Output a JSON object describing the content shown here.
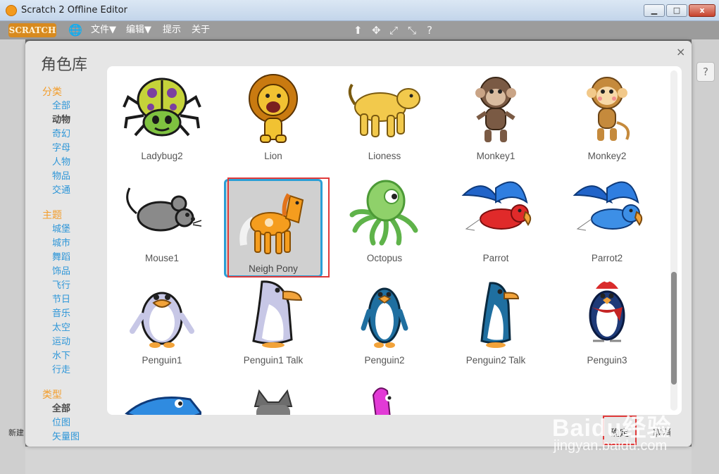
{
  "window": {
    "title": "Scratch 2 Offline Editor",
    "min_glyph": "▁",
    "max_glyph": "□",
    "close_glyph": "x"
  },
  "menubar": {
    "logo": "SCRATCH",
    "globe_glyph": "🌐",
    "file": "文件▼",
    "edit": "编辑▼",
    "tips": "提示",
    "about": "关于",
    "tools": [
      "⬆",
      "✥",
      "⤢",
      "⤡",
      "?"
    ]
  },
  "dialog": {
    "title": "角色库",
    "close_glyph": "×",
    "ok_label": "确定",
    "cancel_label": "取消"
  },
  "sidebar": {
    "category_heading": "分类",
    "categories": [
      "全部",
      "动物",
      "奇幻",
      "字母",
      "人物",
      "物品",
      "交通"
    ],
    "selected_category": "动物",
    "theme_heading": "主题",
    "themes": [
      "城堡",
      "城市",
      "舞蹈",
      "饰品",
      "飞行",
      "节日",
      "音乐",
      "太空",
      "运动",
      "水下",
      "行走"
    ],
    "type_heading": "类型",
    "types": [
      "全部",
      "位图",
      "矢量图"
    ],
    "selected_type": "全部"
  },
  "sprites": [
    {
      "name": "Ladybug2",
      "icon": "ladybug-icon"
    },
    {
      "name": "Lion",
      "icon": "lion-icon"
    },
    {
      "name": "Lioness",
      "icon": "lioness-icon"
    },
    {
      "name": "Monkey1",
      "icon": "monkey-icon"
    },
    {
      "name": "Monkey2",
      "icon": "monkey-icon"
    },
    {
      "name": "Mouse1",
      "icon": "mouse-icon"
    },
    {
      "name": "Neigh Pony",
      "icon": "pony-icon",
      "selected": true
    },
    {
      "name": "Octopus",
      "icon": "octopus-icon"
    },
    {
      "name": "Parrot",
      "icon": "parrot-icon"
    },
    {
      "name": "Parrot2",
      "icon": "parrot-icon"
    },
    {
      "name": "Penguin1",
      "icon": "penguin-icon"
    },
    {
      "name": "Penguin1 Talk",
      "icon": "penguin-icon"
    },
    {
      "name": "Penguin2",
      "icon": "penguin-icon"
    },
    {
      "name": "Penguin2 Talk",
      "icon": "penguin-icon"
    },
    {
      "name": "Penguin3",
      "icon": "penguin-icon"
    }
  ],
  "background": {
    "help_glyph": "?",
    "new_sprite_label": "新建"
  },
  "watermark": {
    "brand": "Baidu经验",
    "url": "jingyan.baidu.com"
  },
  "colors": {
    "accent_blue": "#2e96d8",
    "accent_orange": "#f39d2b",
    "selection_border": "#2a9fd6",
    "highlight_red": "#e03a3a"
  }
}
